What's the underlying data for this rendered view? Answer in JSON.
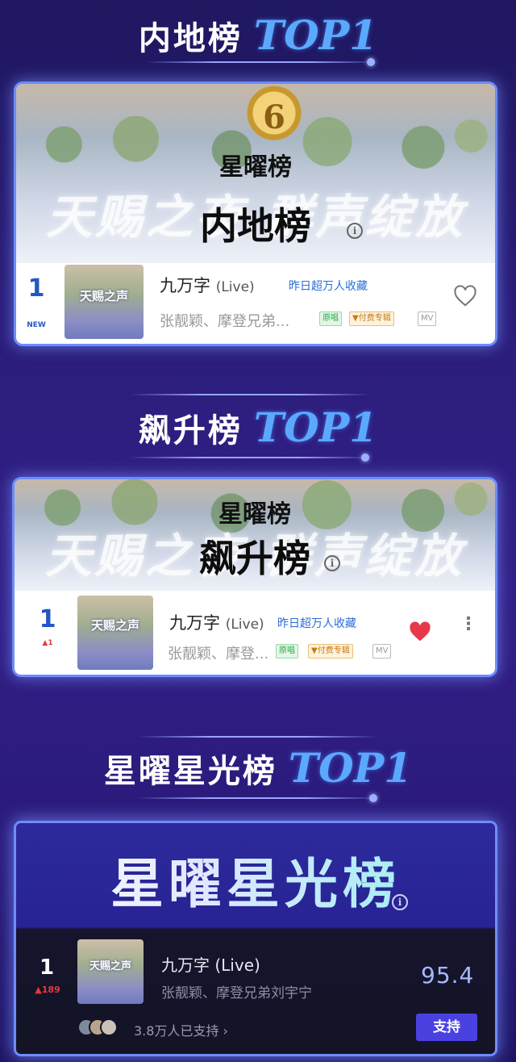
{
  "sections": [
    {
      "title_cn": "内地榜",
      "title_top": "TOP1",
      "banner": {
        "medal_number": "6",
        "small_title": "星曜榜",
        "faded_slogan": "天赐之夜 群声绽放",
        "big_title": "内地榜",
        "info_glyph": "i"
      },
      "entry": {
        "rank": "1",
        "rank_change": "NEW",
        "cover_text": "天赐之声",
        "song": "九万字",
        "song_suffix": "(Live)",
        "collect_note": "昨日超万人收藏",
        "artist": "张靓颖、摩登兄弟...",
        "tags": [
          "原唱",
          "▼付费专辑",
          "MV"
        ]
      }
    },
    {
      "title_cn": "飙升榜",
      "title_top": "TOP1",
      "banner": {
        "small_title": "星曜榜",
        "faded_slogan": "天赐之夜 群声绽放",
        "big_title": "飙升榜",
        "info_glyph": "i"
      },
      "entry": {
        "rank": "1",
        "rank_change": "▲1",
        "cover_text": "天赐之声",
        "song": "九万字",
        "song_suffix": "(Live)",
        "collect_note": "昨日超万人收藏",
        "artist": "张靓颖、摩登...",
        "tags": [
          "原唱",
          "▼付费专辑",
          "MV"
        ],
        "more_glyph": "⋮"
      }
    },
    {
      "title_cn": "星曜星光榜",
      "title_top": "TOP1",
      "banner": {
        "big_title": "星曜星光榜",
        "info_glyph": "i"
      },
      "entry": {
        "rank": "1",
        "rank_change": "▲189",
        "cover_text": "天赐之声",
        "song": "九万字 (Live)",
        "artist": "张靓颖、摩登兄弟刘宇宁",
        "score": "95.4",
        "support_count": "3.8万人已支持 ›",
        "support_button": "支持"
      }
    }
  ],
  "colors": {
    "accent_blue": "#2457c5",
    "top_text": "#5aa9ff",
    "heart_red": "#e8384a",
    "support_button": "#4a42e0"
  }
}
